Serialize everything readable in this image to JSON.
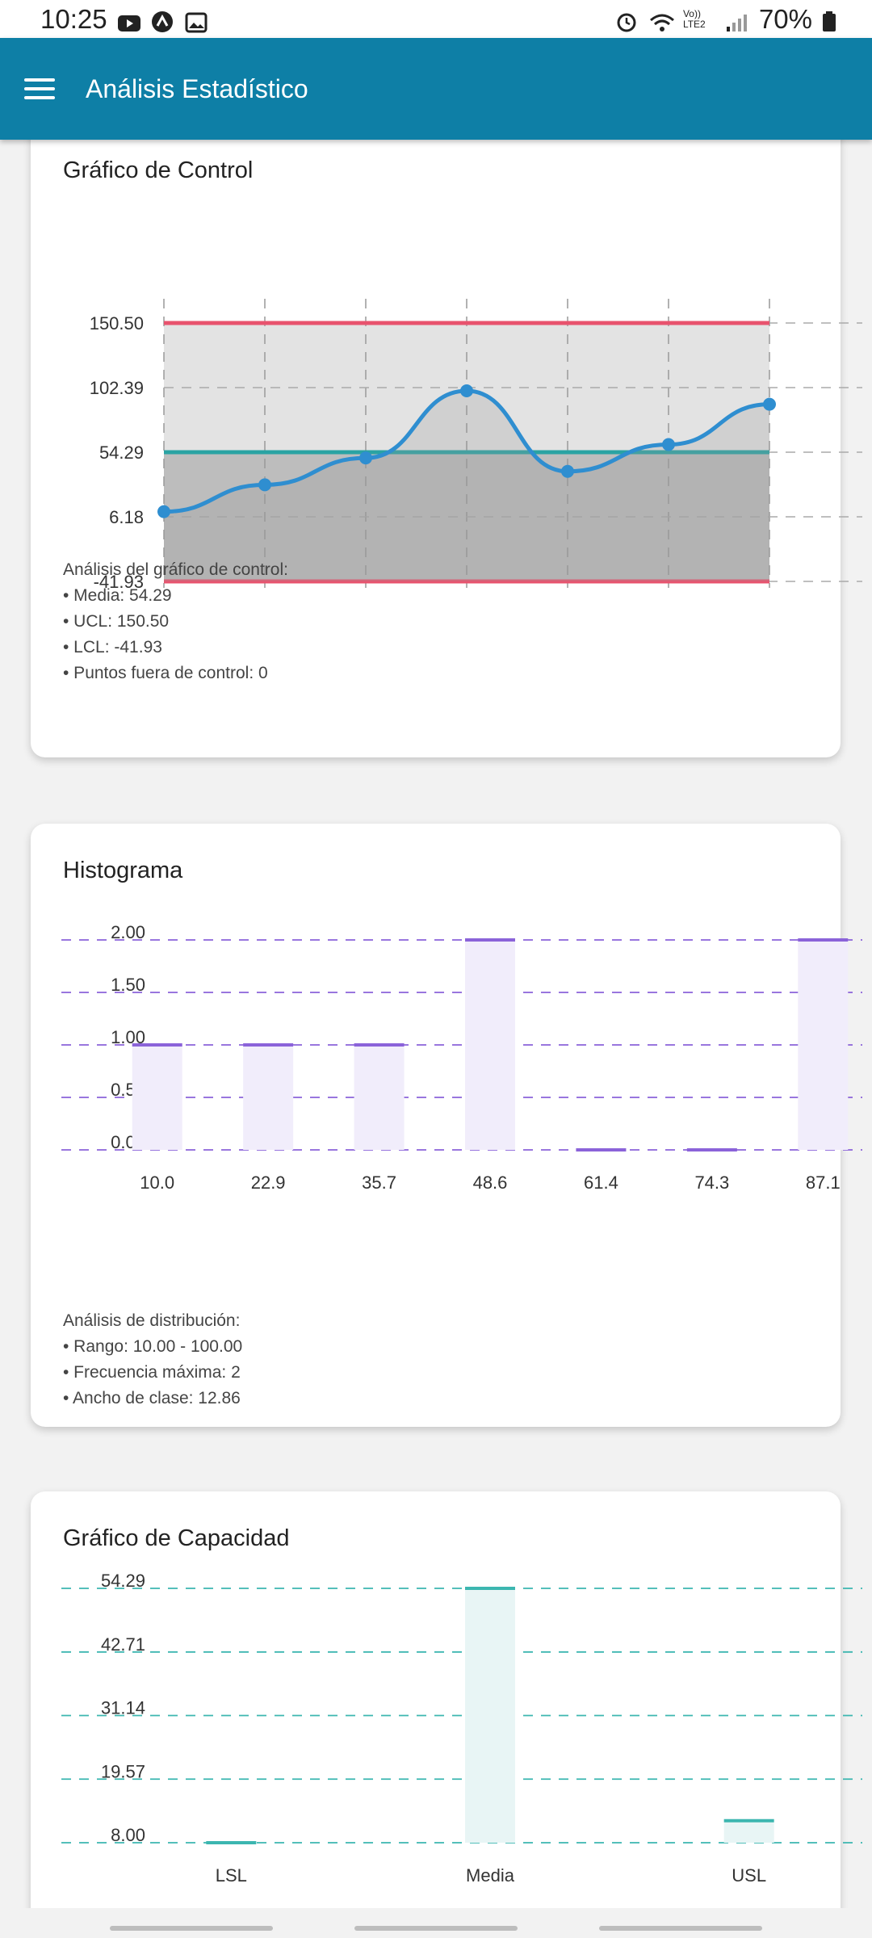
{
  "status": {
    "time": "10:25",
    "battery": "70%",
    "network": "Vo)) LTE2"
  },
  "app": {
    "title": "Análisis Estadístico"
  },
  "control_card": {
    "title": "Gráfico de Control",
    "analysis": [
      "Análisis del gráfico de control:",
      "• Media: 54.29",
      "• UCL: 150.50",
      "• LCL: -41.93",
      "• Puntos fuera de control: 0"
    ]
  },
  "histogram_card": {
    "title": "Histograma",
    "analysis": [
      "Análisis de distribución:",
      "• Rango: 10.00 - 100.00",
      "• Frecuencia máxima: 2",
      "• Ancho de clase: 12.86"
    ]
  },
  "capacity_card": {
    "title": "Gráfico de Capacidad"
  },
  "chart_data": [
    {
      "type": "line",
      "title": "Gráfico de Control",
      "ylim": [
        -41.93,
        150.5
      ],
      "yticks": [
        "150.50",
        "102.39",
        "54.29",
        "6.18",
        "-41.93"
      ],
      "x": [
        0,
        1,
        2,
        3,
        4,
        5,
        6
      ],
      "values": [
        10,
        30,
        50,
        100,
        40,
        60,
        90
      ],
      "center": 54.29,
      "ucl": 150.5,
      "lcl": -41.93,
      "colors": {
        "line": "#2f8ed0",
        "ucl": "#e8536e",
        "center": "#2aa3a3",
        "fill_above": "#e3e3e3",
        "fill_below": "#bdbdbd"
      }
    },
    {
      "type": "bar",
      "title": "Histograma",
      "categories": [
        "10.0",
        "22.9",
        "35.7",
        "48.6",
        "61.4",
        "74.3",
        "87.1"
      ],
      "values": [
        1,
        1,
        1,
        2,
        0,
        0,
        2
      ],
      "ylim": [
        0,
        2
      ],
      "yticks": [
        "2.00",
        "1.50",
        "1.00",
        "0.50",
        "0.00"
      ],
      "colors": {
        "bar": "#f1edfb",
        "cap": "#8b63d9",
        "grid": "#8b63d9"
      }
    },
    {
      "type": "bar",
      "title": "Gráfico de Capacidad",
      "categories": [
        "LSL",
        "Media",
        "USL"
      ],
      "values": [
        8.0,
        54.29,
        12.0
      ],
      "ylim": [
        8.0,
        54.29
      ],
      "yticks": [
        "54.29",
        "42.71",
        "31.14",
        "19.57",
        "8.00"
      ],
      "colors": {
        "bar": "#e8f5f5",
        "cap": "#3cb6b0",
        "grid": "#3cb6b0"
      }
    }
  ]
}
